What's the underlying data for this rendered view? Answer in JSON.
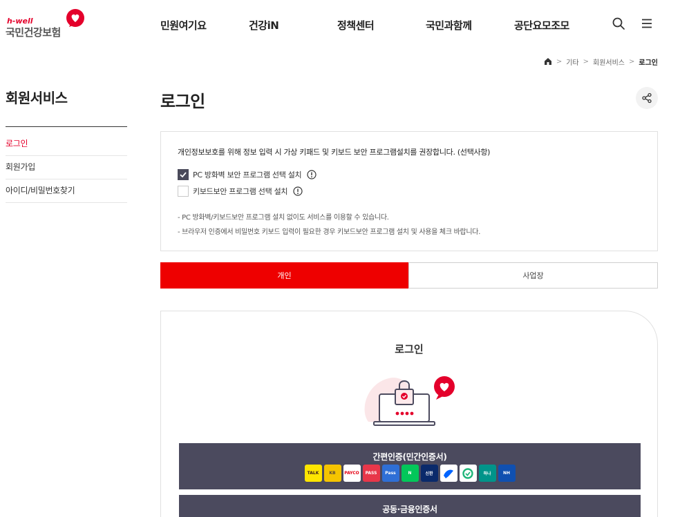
{
  "logo": {
    "brand_small": "h-well",
    "brand_name": "국민건강보험"
  },
  "nav": [
    {
      "label": "민원여기요"
    },
    {
      "label": "건강iN"
    },
    {
      "label": "정책센터"
    },
    {
      "label": "국민과함께"
    },
    {
      "label": "공단요모조모"
    }
  ],
  "header_icons": [
    "search-icon",
    "menu-icon"
  ],
  "breadcrumb": {
    "items": [
      "기타",
      "회원서비스"
    ],
    "current": "로그인"
  },
  "sidebar": {
    "title": "회원서비스",
    "items": [
      {
        "label": "로그인",
        "active": true
      },
      {
        "label": "회원가입",
        "active": false
      },
      {
        "label": "아이디/비밀번호찾기",
        "active": false
      }
    ]
  },
  "page_title": "로그인",
  "notice": {
    "heading": "개인정보보호를 위해 정보 입력 시 가상 키패드 및 키보드 보안 프로그램설치를 권장합니다. (선택사항)",
    "options": [
      {
        "label": "PC 방화벽 보안 프로그램 선택 설치",
        "checked": true
      },
      {
        "label": "키보드보안 프로그램 선택 설치",
        "checked": false
      }
    ],
    "notes": [
      "-  PC 방화벽/키보드보안 프로그램 설치 없이도 서비스를 이용할 수 있습니다.",
      "-  브라우저 인증에서 비밀번호 키보드 입력이 필요한 경우 키보드보안 프로그램 설치 및 사용을 체크 바랍니다."
    ]
  },
  "tabs": [
    {
      "label": "개인",
      "active": true
    },
    {
      "label": "사업장",
      "active": false
    }
  ],
  "login": {
    "title": "로그인",
    "simple_auth_label": "간편인증(민간인증서)",
    "providers": [
      {
        "text": "TALK",
        "bg": "#fee500",
        "fg": "#3c1e1e"
      },
      {
        "text": "KB",
        "bg": "#f5c400",
        "fg": "#5a4a3a"
      },
      {
        "text": "PAYCO",
        "bg": "#ffffff",
        "fg": "#e60012"
      },
      {
        "text": "PASS",
        "bg": "#e8374a",
        "fg": "#ffffff"
      },
      {
        "text": "Pass",
        "bg": "#2f6fd6",
        "fg": "#ffffff"
      },
      {
        "text": "N",
        "bg": "#03c75a",
        "fg": "#ffffff"
      },
      {
        "text": "신한",
        "bg": "#0a2a6b",
        "fg": "#ffffff"
      },
      {
        "text": "",
        "bg": "#ffffff",
        "fg": "#0064ff"
      },
      {
        "text": "",
        "bg": "#ffffff",
        "fg": "#1fb67a"
      },
      {
        "text": "하나",
        "bg": "#00948a",
        "fg": "#ffffff"
      },
      {
        "text": "NH",
        "bg": "#1050b0",
        "fg": "#ffffff"
      }
    ],
    "cert_label": "공동·금융인증서"
  },
  "colors": {
    "accent": "#ee0000",
    "brand_red": "#e4002b",
    "button_dark": "#4b4a5e"
  }
}
